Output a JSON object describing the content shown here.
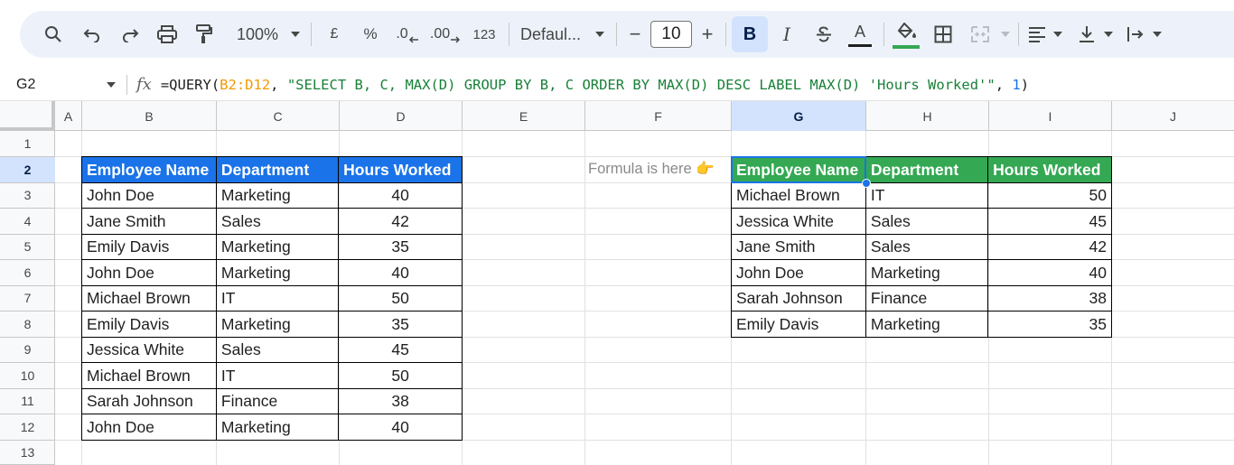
{
  "toolbar": {
    "zoom": "100%",
    "currency": "£",
    "percent": "%",
    "decrease_decimal": ".0",
    "increase_decimal": ".00",
    "number_format": "123",
    "font": "Defaul...",
    "font_size": "10",
    "minus": "−",
    "plus": "+",
    "bold": "B",
    "italic": "I",
    "text_color": "A"
  },
  "formula_bar": {
    "cell_ref": "G2",
    "formula_prefix": "=QUERY(",
    "formula_range": "B2:D12",
    "formula_sep1": ", ",
    "formula_query": "\"SELECT B, C, MAX(D) GROUP BY B, C ORDER BY MAX(D) DESC LABEL MAX(D) 'Hours Worked'\"",
    "formula_sep2": ", ",
    "formula_headers": "1",
    "formula_suffix": ")"
  },
  "columns": [
    "A",
    "B",
    "C",
    "D",
    "E",
    "F",
    "G",
    "H",
    "I",
    "J"
  ],
  "rows": [
    "1",
    "2",
    "3",
    "4",
    "5",
    "6",
    "7",
    "8",
    "9",
    "10",
    "11",
    "12",
    "13"
  ],
  "source_table": {
    "headers": [
      "Employee Name",
      "Department",
      "Hours Worked"
    ],
    "rows": [
      [
        "John Doe",
        "Marketing",
        "40"
      ],
      [
        "Jane Smith",
        "Sales",
        "42"
      ],
      [
        "Emily Davis",
        "Marketing",
        "35"
      ],
      [
        "John Doe",
        "Marketing",
        "40"
      ],
      [
        "Michael Brown",
        "IT",
        "50"
      ],
      [
        "Emily Davis",
        "Marketing",
        "35"
      ],
      [
        "Jessica White",
        "Sales",
        "45"
      ],
      [
        "Michael Brown",
        "IT",
        "50"
      ],
      [
        "Sarah Johnson",
        "Finance",
        "38"
      ],
      [
        "John Doe",
        "Marketing",
        "40"
      ]
    ]
  },
  "note": "Formula is here 👉",
  "result_table": {
    "headers": [
      "Employee Name",
      "Department",
      "Hours Worked"
    ],
    "rows": [
      [
        "Michael Brown",
        "IT",
        "50"
      ],
      [
        "Jessica White",
        "Sales",
        "45"
      ],
      [
        "Jane Smith",
        "Sales",
        "42"
      ],
      [
        "John Doe",
        "Marketing",
        "40"
      ],
      [
        "Sarah Johnson",
        "Finance",
        "38"
      ],
      [
        "Emily Davis",
        "Marketing",
        "35"
      ]
    ]
  },
  "colors": {
    "source_header": "#1a73e8",
    "result_header": "#34a853",
    "selection": "#1a73e8"
  }
}
